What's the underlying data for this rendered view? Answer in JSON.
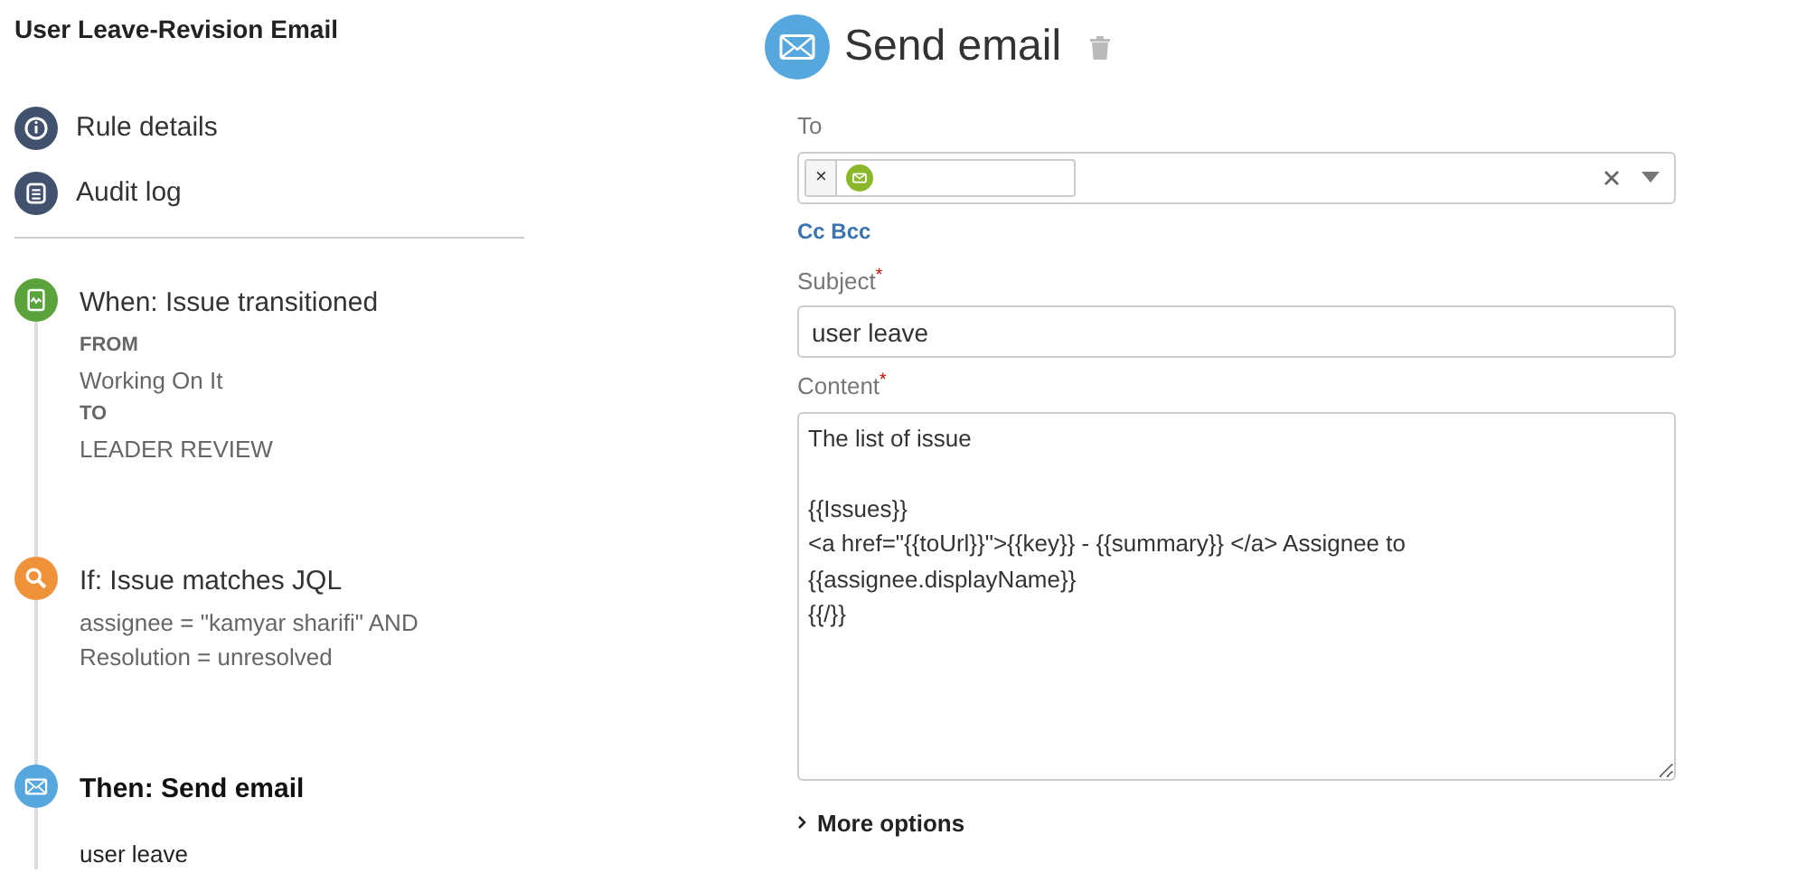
{
  "rule_title": "User Leave-Revision Email",
  "nav": [
    {
      "label": "Rule details",
      "kind": "info"
    },
    {
      "label": "Audit log",
      "kind": "log"
    }
  ],
  "steps": [
    {
      "kind": "trigger",
      "title": "When: Issue transitioned",
      "selected": false,
      "lines": [
        {
          "kind": "label",
          "text": "FROM"
        },
        {
          "kind": "value",
          "text": "Working On It"
        },
        {
          "kind": "label",
          "text": "TO"
        },
        {
          "kind": "value",
          "text": "LEADER REVIEW"
        }
      ]
    },
    {
      "kind": "condition",
      "title": "If: Issue matches JQL",
      "selected": false,
      "lines": [
        {
          "kind": "value",
          "text": "assignee = \"kamyar sharifi\" AND"
        },
        {
          "kind": "value",
          "text": "Resolution = unresolved"
        }
      ]
    },
    {
      "kind": "action",
      "title": "Then: Send email",
      "selected": true,
      "lines": [
        {
          "kind": "value",
          "text": "user leave"
        }
      ]
    }
  ],
  "editor": {
    "title": "Send email",
    "to": {
      "label": "To",
      "recipients": [
        {
          "kind": "email",
          "remove": "×"
        }
      ]
    },
    "cc_bcc": "Cc Bcc",
    "subject": {
      "label": "Subject",
      "required": true,
      "required_mark": "*",
      "value": "user leave"
    },
    "content": {
      "label": "Content",
      "required": true,
      "required_mark": "*",
      "value": "The list of issue\n\n{{Issues}}\n<a href=\"{{toUrl}}\">{{key}} - {{summary}} </a> Assignee to\n{{assignee.displayName}}\n{{/}}"
    },
    "more_options": "More options"
  }
}
